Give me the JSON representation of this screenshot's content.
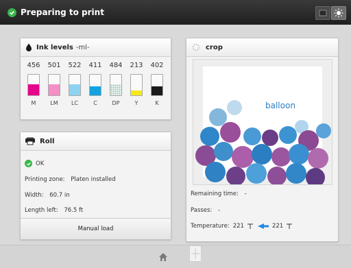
{
  "header": {
    "title": "Preparing to print",
    "status": "ok"
  },
  "ink_panel": {
    "title": "Ink levels",
    "unit": "-ml-",
    "inks": [
      {
        "label": "M",
        "value": "456",
        "color": "#e5068a",
        "level": 0.55
      },
      {
        "label": "LM",
        "value": "501",
        "color": "#f58fc6",
        "level": 0.55
      },
      {
        "label": "LC",
        "value": "522",
        "color": "#8fd3f2",
        "level": 0.55
      },
      {
        "label": "C",
        "value": "411",
        "color": "#14a3e0",
        "level": 0.45
      },
      {
        "label": "DP",
        "value": "484",
        "color": "#e6f2ee",
        "level": 0.55
      },
      {
        "label": "Y",
        "value": "213",
        "color": "#f7e81c",
        "level": 0.25
      },
      {
        "label": "K",
        "value": "402",
        "color": "#1a1a1a",
        "level": 0.45
      }
    ]
  },
  "roll_panel": {
    "title": "Roll",
    "status": "OK",
    "printing_zone_label": "Printing zone:",
    "printing_zone_value": "Platen installed",
    "width_label": "Width:",
    "width_value": "60.7 in",
    "length_label": "Length left:",
    "length_value": "76.5 ft",
    "button_label": "Manual load"
  },
  "job_panel": {
    "title": "crop",
    "preview_text": "balloon",
    "remaining_label": "Remaining time:",
    "remaining_value": "-",
    "passes_label": "Passes:",
    "passes_value": "-",
    "temperature_label": "Temperature:",
    "temperature_current": "221",
    "temperature_target": "221"
  },
  "bottom_bar": {
    "home_icon": "home-icon",
    "window_icon": "window-icon"
  },
  "colors": {
    "ok_green": "#39b54a",
    "accent_blue": "#1e88e5"
  }
}
